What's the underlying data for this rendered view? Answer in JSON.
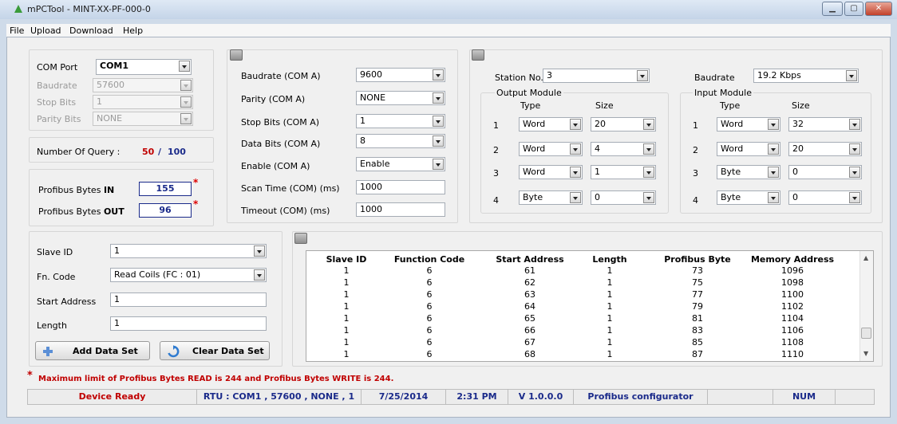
{
  "window": {
    "title": "mPCTool - MINT-XX-PF-000-0"
  },
  "menu": [
    "File",
    "Upload",
    "Download",
    "Help"
  ],
  "com_settings": {
    "com_port_label": "COM Port",
    "com_port_value": "COM1",
    "baudrate_label": "Baudrate",
    "baudrate_value": "57600",
    "stop_bits_label": "Stop Bits",
    "stop_bits_value": "1",
    "parity_bits_label": "Parity Bits",
    "parity_bits_value": "NONE"
  },
  "query": {
    "label": "Number Of Query :",
    "current": "50",
    "separator": "/",
    "max": "100"
  },
  "profibus": {
    "in_label_prefix": "Profibus Bytes",
    "in_label_bold": "IN",
    "in_value": "155",
    "out_label_prefix": "Profibus Bytes",
    "out_label_bold": "OUT",
    "out_value": "96",
    "star": "*"
  },
  "com_a": {
    "baudrate_label": "Baudrate (COM A)",
    "baudrate_value": "9600",
    "parity_label": "Parity (COM A)",
    "parity_value": "NONE",
    "stop_bits_label": "Stop Bits (COM A)",
    "stop_bits_value": "1",
    "data_bits_label": "Data Bits (COM A)",
    "data_bits_value": "8",
    "enable_label": "Enable (COM A)",
    "enable_value": "Enable",
    "scan_time_label": "Scan Time (COM) (ms)",
    "scan_time_value": "1000",
    "timeout_label": "Timeout (COM) (ms)",
    "timeout_value": "1000"
  },
  "station": {
    "station_label": "Station No.",
    "station_value": "3",
    "baudrate_label": "Baudrate",
    "baudrate_value": "19.2 Kbps"
  },
  "output_module": {
    "title": "Output Module",
    "type_header": "Type",
    "size_header": "Size",
    "rows": [
      {
        "n": "1",
        "type": "Word",
        "size": "20"
      },
      {
        "n": "2",
        "type": "Word",
        "size": "4"
      },
      {
        "n": "3",
        "type": "Word",
        "size": "1"
      },
      {
        "n": "4",
        "type": "Byte",
        "size": "0"
      }
    ]
  },
  "input_module": {
    "title": "Input Module",
    "type_header": "Type",
    "size_header": "Size",
    "rows": [
      {
        "n": "1",
        "type": "Word",
        "size": "32"
      },
      {
        "n": "2",
        "type": "Word",
        "size": "20"
      },
      {
        "n": "3",
        "type": "Byte",
        "size": "0"
      },
      {
        "n": "4",
        "type": "Byte",
        "size": "0"
      }
    ]
  },
  "dataset": {
    "slave_id_label": "Slave ID",
    "slave_id_value": "1",
    "fn_code_label": "Fn. Code",
    "fn_code_value": "Read Coils (FC : 01)",
    "start_address_label": "Start Address",
    "start_address_value": "1",
    "length_label": "Length",
    "length_value": "1",
    "add_button": "Add Data Set",
    "clear_button": "Clear Data Set"
  },
  "table": {
    "headers": [
      "Slave ID",
      "Function Code",
      "Start Address",
      "Length",
      "Profibus Byte",
      "Memory Address"
    ],
    "rows": [
      [
        "1",
        "6",
        "61",
        "1",
        "73",
        "1096"
      ],
      [
        "1",
        "6",
        "62",
        "1",
        "75",
        "1098"
      ],
      [
        "1",
        "6",
        "63",
        "1",
        "77",
        "1100"
      ],
      [
        "1",
        "6",
        "64",
        "1",
        "79",
        "1102"
      ],
      [
        "1",
        "6",
        "65",
        "1",
        "81",
        "1104"
      ],
      [
        "1",
        "6",
        "66",
        "1",
        "83",
        "1106"
      ],
      [
        "1",
        "6",
        "67",
        "1",
        "85",
        "1108"
      ],
      [
        "1",
        "6",
        "68",
        "1",
        "87",
        "1110"
      ]
    ]
  },
  "warning": {
    "star": "*",
    "text": "Maximum limit of Profibus Bytes READ is 244 and Profibus Bytes WRITE is 244."
  },
  "status": {
    "device": "Device Ready",
    "connection": "RTU : COM1 , 57600 , NONE , 1",
    "date": "7/25/2014",
    "time": "2:31 PM",
    "version": "V 1.0.0.0",
    "app": "Profibus configurator",
    "blank": "",
    "num": "NUM"
  },
  "colors": {
    "accent_red": "#c00000",
    "accent_blue": "#1a2a8a",
    "close_red": "#c2412b"
  }
}
